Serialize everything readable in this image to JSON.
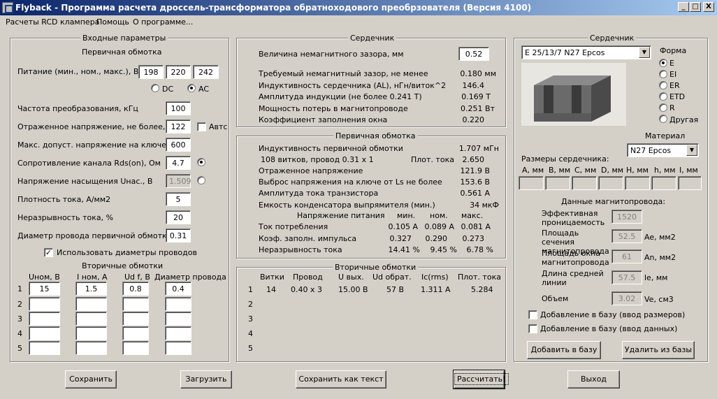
{
  "title": "Flyback - Программа расчета дроссель-трансформатора обратноходового преобрзователя (Версия 4100)",
  "window_buttons": {
    "min": "_",
    "max": "□",
    "close": "X"
  },
  "menu": [
    "Расчеты RCD клампера",
    "Помощь",
    "О программе..."
  ],
  "input": {
    "title": "Входные параметры",
    "primary_title": "Первичная обмотка",
    "supply_label": "Питание (мин., ном., макс.), В",
    "supply": [
      "198",
      "220",
      "242"
    ],
    "dc": "DC",
    "ac": "AC",
    "freq_label": "Частота преобразования, кГц",
    "freq": "100",
    "refl_label": "Отраженное напряжение, не более, В",
    "refl": "122",
    "auto": "Автс",
    "vmax_label": "Макс. допуст. напряжение на ключе, В",
    "vmax": "600",
    "rds_label": "Сопротивление канала Rds(on), Ом",
    "rds": "4.7",
    "usat_label": "Напряжение насыщения Uнас., В",
    "usat": "1.509",
    "j_label": "Плотность тока, А/мм2",
    "j": "5",
    "disc_label": "Неразрывность тока, %",
    "disc": "20",
    "dia_label": "Диаметр провода первичной обмотки",
    "dia": "0.31",
    "use_dia": "Использовать диаметры проводов",
    "sec_title": "Вторичные обмотки",
    "sec_headers": [
      "Uном, В",
      "I ном, А",
      "Ud f, В",
      "Диаметр провода"
    ],
    "sec_rows": [
      [
        "1",
        "15",
        "1.5",
        "0.8",
        "0.4"
      ],
      [
        "2",
        "",
        "",
        "",
        ""
      ],
      [
        "3",
        "",
        "",
        "",
        ""
      ],
      [
        "4",
        "",
        "",
        "",
        ""
      ],
      [
        "5",
        "",
        "",
        "",
        ""
      ]
    ]
  },
  "core_res": {
    "title": "Сердечник",
    "gap_label": "Величина немагнитного зазора, мм",
    "gap": "0.52",
    "rows": [
      [
        "Требуемый немагнитный зазор, не менее",
        "0.180 мм"
      ],
      [
        "Индуктивность сердечника (AL), нГн/виток^2",
        "146.4"
      ],
      [
        "Амплитуда индукции     (не более 0.241 Т)",
        "0.169 Т"
      ],
      [
        "Мощность потерь в магнитопроводе",
        "0.251 Вт"
      ],
      [
        "Коэффициент заполнения окна",
        "0.220"
      ]
    ]
  },
  "primary_res": {
    "title": "Первичная обмотка",
    "l_label": "Индуктивность первичной обмотки",
    "l": "1.707 мГн",
    "turns": "108 витков,  провод  0.31 x 1",
    "jlabel": "Плот. тока",
    "jval": "2.650",
    "refl_label": "Отраженное напряжение",
    "refl": "121.9 В",
    "spike_label": "Выброс напряжения на ключе от Ls не более",
    "spike": "153.6 В",
    "ipk_label": "Амплитуда тока транзистора",
    "ipk": "0.561 А",
    "cap_label": "Емкость конденсатора выпрямителя (мин.)",
    "cap": "34 мкФ",
    "sup_label": "Напряжение питания",
    "hdr": [
      "мин.",
      "ном.",
      "макс."
    ],
    "table": [
      [
        "Ток потребления",
        "0.105 А",
        "0.089 А",
        "0.081 А"
      ],
      [
        "Коэф. заполн. импульса",
        "0.327",
        "0.290",
        "0.273"
      ],
      [
        "Неразрывность тока",
        "14.41 %",
        "9.45 %",
        "6.78 %"
      ]
    ]
  },
  "secondary_res": {
    "title": "Вторичные обмотки",
    "headers": [
      "Витки",
      "Провод",
      "U вых.",
      "Ud обрат.",
      "Ic(rms)",
      "Плот. тока"
    ],
    "rows": [
      [
        "1",
        "14",
        "0.40 x 3",
        "15.00 В",
        "57 В",
        "1.311 А",
        "5.284"
      ],
      [
        "2"
      ],
      [
        "3"
      ],
      [
        "4"
      ],
      [
        "5"
      ]
    ]
  },
  "core_sel": {
    "title": "Сердечник",
    "core": "E 25/13/7 N27 Epcos",
    "form_label": "Форма",
    "forms": [
      "E",
      "EI",
      "ER",
      "ETD",
      "R",
      "Другая"
    ],
    "material_label": "Материал",
    "material": "N27 Epcos",
    "dims_label": "Размеры сердечника:",
    "dims": [
      "A, мм",
      "B, мм",
      "C, мм",
      "D, мм",
      "H, мм",
      "h, мм",
      "I, мм"
    ],
    "mag_title": "Данные магнитопровода:",
    "mag": [
      [
        "Эффективная проницаемость",
        "1520",
        ""
      ],
      [
        "Площадь сечения магнитопровода",
        "52.5",
        "Ae, мм2"
      ],
      [
        "Площадь окна магнитопровода",
        "61",
        "An, мм2"
      ],
      [
        "Длина средней линии",
        "57.5",
        "le, мм"
      ],
      [
        "Объем",
        "3.02",
        "Ve, см3"
      ]
    ],
    "add_dims": "Добавление в базу (ввод размеров)",
    "add_data": "Добавление в базу (ввод данных)",
    "add_btn": "Добавить в базу",
    "del_btn": "Удалить из базы"
  },
  "buttons": {
    "save": "Сохранить",
    "load": "Загрузить",
    "save_text": "Сохранить как текст",
    "calc": "Рассчитать!",
    "exit": "Выход"
  }
}
